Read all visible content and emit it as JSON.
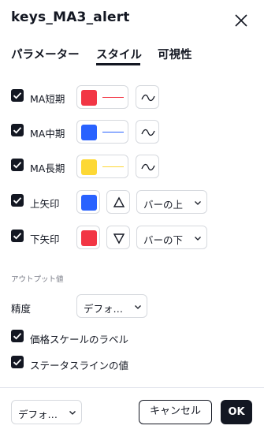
{
  "dialog": {
    "title": "keys_MA3_alert"
  },
  "tabs": [
    {
      "label": "パラメーター"
    },
    {
      "label": "スタイル"
    },
    {
      "label": "可視性"
    }
  ],
  "style_rows": [
    {
      "label": "MA短期",
      "checked": true,
      "color": "#f23645"
    },
    {
      "label": "MA中期",
      "checked": true,
      "color": "#2962ff"
    },
    {
      "label": "MA長期",
      "checked": true,
      "color": "#fdd835"
    },
    {
      "label": "上矢印",
      "checked": true,
      "color": "#2962ff",
      "shape": "up-triangle",
      "location": "バーの上"
    },
    {
      "label": "下矢印",
      "checked": true,
      "color": "#f23645",
      "shape": "down-triangle",
      "location": "バーの下"
    }
  ],
  "output": {
    "section_title": "アウトプット値",
    "precision_label": "精度",
    "precision_value": "デフォ…",
    "price_scale_label": "価格スケールのラベル",
    "status_line_label": "ステータスラインの値"
  },
  "footer": {
    "defaults_value": "デフォ…",
    "cancel_label": "キャンセル",
    "ok_label": "OK"
  }
}
